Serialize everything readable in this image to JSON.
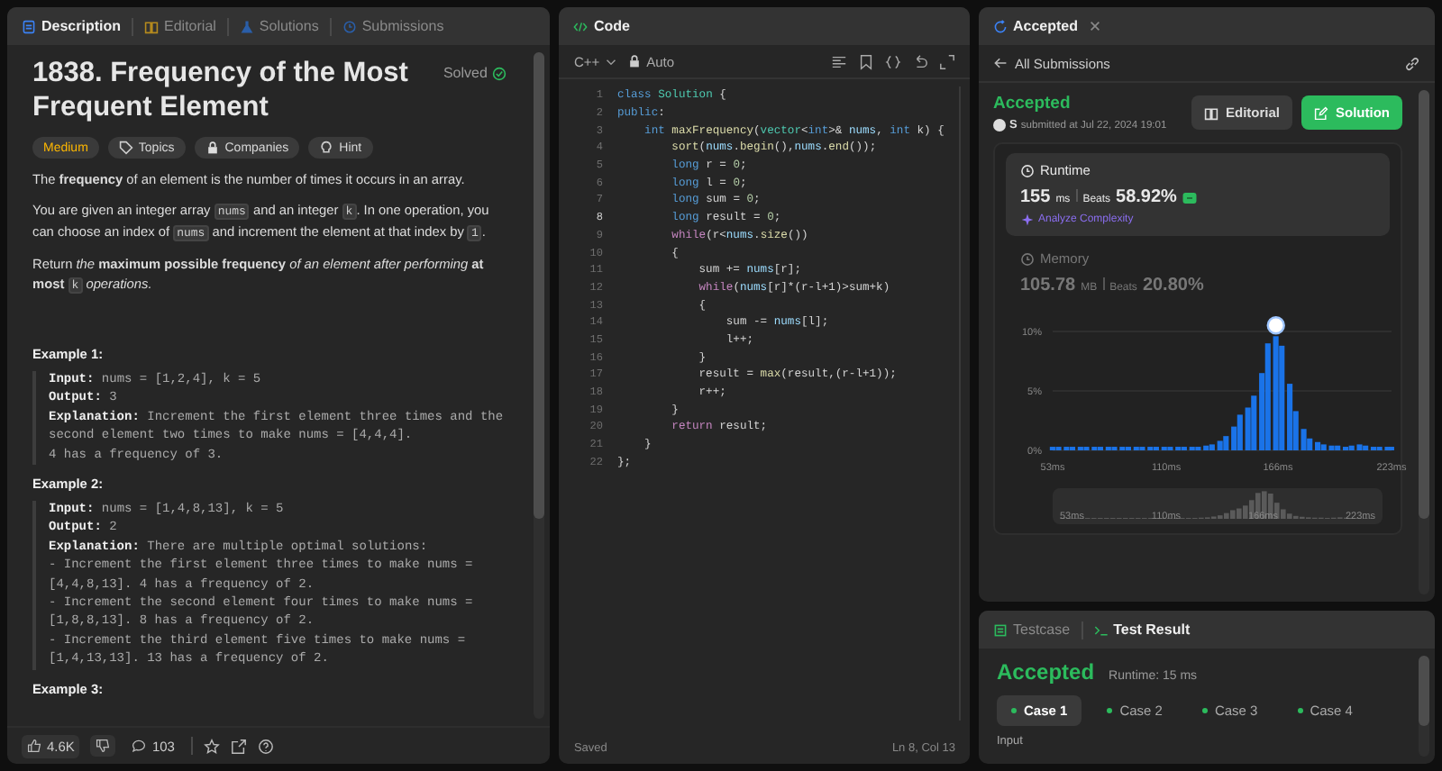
{
  "description_panel": {
    "tabs": [
      {
        "label": "Description",
        "kind": "doc",
        "selected": true
      },
      {
        "label": "Editorial",
        "kind": "book",
        "selected": false
      },
      {
        "label": "Solutions",
        "kind": "flask",
        "selected": false
      },
      {
        "label": "Submissions",
        "kind": "history",
        "selected": false
      }
    ],
    "title": "1838. Frequency of the Most Frequent Element",
    "status": "Solved",
    "tags": [
      {
        "label": "Medium",
        "kind": "difficulty"
      },
      {
        "label": "Topics",
        "kind": "tag"
      },
      {
        "label": "Companies",
        "kind": "lock"
      },
      {
        "label": "Hint",
        "kind": "bulb"
      }
    ],
    "paragraphs": [
      [
        {
          "kind": "text",
          "text": "The **frequency** of an element is the number of times it occurs in an array."
        }
      ],
      [
        {
          "kind": "text",
          "text": "You are given an integer array "
        },
        {
          "kind": "code",
          "text": "nums"
        },
        {
          "kind": "text",
          "text": " and an integer "
        },
        {
          "kind": "code",
          "text": "k"
        },
        {
          "kind": "text",
          "text": ". In one operation, you can choose an index of "
        },
        {
          "kind": "code",
          "text": "nums"
        },
        {
          "kind": "text",
          "text": " and increment the element at that index by "
        },
        {
          "kind": "code",
          "text": "1"
        },
        {
          "kind": "text",
          "text": "."
        }
      ],
      [
        {
          "kind": "text",
          "text": "Return *the* **maximum possible frequency** *of an element after performing* **at most** "
        },
        {
          "kind": "code",
          "text": "k"
        },
        {
          "kind": "text",
          "text": " *operations.*"
        }
      ]
    ],
    "examples": [
      {
        "heading": "Example 1:",
        "lines": [
          "**Input:** nums = [1,2,4], k = 5",
          "**Output:** 3",
          "**Explanation:** Increment the first element three times and the second element two times to make nums = [4,4,4].",
          "4 has a frequency of 3."
        ]
      },
      {
        "heading": "Example 2:",
        "lines": [
          "**Input:** nums = [1,4,8,13], k = 5",
          "**Output:** 2",
          "**Explanation:** There are multiple optimal solutions:",
          "- Increment the first element three times to make nums = [4,4,8,13]. 4 has a frequency of 2.",
          "- Increment the second element four times to make nums = [1,8,8,13]. 8 has a frequency of 2.",
          "- Increment the third element five times to make nums = [1,4,13,13]. 13 has a frequency of 2."
        ]
      },
      {
        "heading": "Example 3:"
      }
    ],
    "footer": {
      "likes": "4.6K",
      "comments": "103"
    }
  },
  "code_panel": {
    "title": "Code",
    "language": "C++",
    "mode": "Auto",
    "lines": [
      {
        "no": "1",
        "current": false,
        "tokens": [
          {
            "kind": "kw",
            "t": "class"
          },
          {
            "kind": "ty",
            "t": " Solution"
          },
          {
            "kind": "p",
            "t": " {"
          }
        ]
      },
      {
        "no": "2",
        "current": false,
        "tokens": [
          {
            "kind": "kw",
            "t": "public"
          },
          {
            "kind": "p",
            "t": ":"
          }
        ]
      },
      {
        "no": "3",
        "current": false,
        "tokens": [
          {
            "kind": "kw",
            "t": "    int"
          },
          {
            "kind": "fn",
            "t": " maxFrequency"
          },
          {
            "kind": "p",
            "t": "("
          },
          {
            "kind": "ty",
            "t": "vector"
          },
          {
            "kind": "p",
            "t": "<"
          },
          {
            "kind": "kw",
            "t": "int"
          },
          {
            "kind": "p",
            "t": ">& "
          },
          {
            "kind": "var",
            "t": "nums"
          },
          {
            "kind": "p",
            "t": ", "
          },
          {
            "kind": "kw",
            "t": "int"
          },
          {
            "kind": "p",
            "t": " k) {"
          }
        ]
      },
      {
        "no": "4",
        "current": false,
        "tokens": [
          {
            "kind": "fn",
            "t": "        sort"
          },
          {
            "kind": "p",
            "t": "("
          },
          {
            "kind": "var",
            "t": "nums"
          },
          {
            "kind": "p",
            "t": "."
          },
          {
            "kind": "fn",
            "t": "begin"
          },
          {
            "kind": "p",
            "t": "(),"
          },
          {
            "kind": "var",
            "t": "nums"
          },
          {
            "kind": "p",
            "t": "."
          },
          {
            "kind": "fn",
            "t": "end"
          },
          {
            "kind": "p",
            "t": "());"
          }
        ]
      },
      {
        "no": "5",
        "current": false,
        "tokens": [
          {
            "kind": "kw",
            "t": "        long"
          },
          {
            "kind": "p",
            "t": " r = "
          },
          {
            "kind": "num",
            "t": "0"
          },
          {
            "kind": "p",
            "t": ";"
          }
        ]
      },
      {
        "no": "6",
        "current": false,
        "tokens": [
          {
            "kind": "kw",
            "t": "        long"
          },
          {
            "kind": "p",
            "t": " l = "
          },
          {
            "kind": "num",
            "t": "0"
          },
          {
            "kind": "p",
            "t": ";"
          }
        ]
      },
      {
        "no": "7",
        "current": false,
        "tokens": [
          {
            "kind": "kw",
            "t": "        long"
          },
          {
            "kind": "p",
            "t": " sum = "
          },
          {
            "kind": "num",
            "t": "0"
          },
          {
            "kind": "p",
            "t": ";"
          }
        ]
      },
      {
        "no": "8",
        "current": true,
        "tokens": [
          {
            "kind": "kw",
            "t": "        long"
          },
          {
            "kind": "p",
            "t": " result = "
          },
          {
            "kind": "num",
            "t": "0"
          },
          {
            "kind": "p",
            "t": ";"
          }
        ]
      },
      {
        "no": "9",
        "current": false,
        "tokens": [
          {
            "kind": "ctl",
            "t": "        while"
          },
          {
            "kind": "p",
            "t": "(r<"
          },
          {
            "kind": "var",
            "t": "nums"
          },
          {
            "kind": "p",
            "t": "."
          },
          {
            "kind": "fn",
            "t": "size"
          },
          {
            "kind": "p",
            "t": "())"
          }
        ]
      },
      {
        "no": "10",
        "current": false,
        "tokens": [
          {
            "kind": "p",
            "t": "        {"
          }
        ]
      },
      {
        "no": "11",
        "current": false,
        "tokens": [
          {
            "kind": "p",
            "t": "            sum += "
          },
          {
            "kind": "var",
            "t": "nums"
          },
          {
            "kind": "p",
            "t": "[r];"
          }
        ]
      },
      {
        "no": "12",
        "current": false,
        "tokens": [
          {
            "kind": "ctl",
            "t": "            while"
          },
          {
            "kind": "p",
            "t": "("
          },
          {
            "kind": "var",
            "t": "nums"
          },
          {
            "kind": "p",
            "t": "[r]*(r-l+1)>sum+k)"
          }
        ]
      },
      {
        "no": "13",
        "current": false,
        "tokens": [
          {
            "kind": "p",
            "t": "            {"
          }
        ]
      },
      {
        "no": "14",
        "current": false,
        "tokens": [
          {
            "kind": "p",
            "t": "                sum -= "
          },
          {
            "kind": "var",
            "t": "nums"
          },
          {
            "kind": "p",
            "t": "[l];"
          }
        ]
      },
      {
        "no": "15",
        "current": false,
        "tokens": [
          {
            "kind": "p",
            "t": "                l++;"
          }
        ]
      },
      {
        "no": "16",
        "current": false,
        "tokens": [
          {
            "kind": "p",
            "t": "            }"
          }
        ]
      },
      {
        "no": "17",
        "current": false,
        "tokens": [
          {
            "kind": "p",
            "t": "            result = "
          },
          {
            "kind": "fn",
            "t": "max"
          },
          {
            "kind": "p",
            "t": "(result,(r-l+1));"
          }
        ]
      },
      {
        "no": "18",
        "current": false,
        "tokens": [
          {
            "kind": "p",
            "t": "            r++;"
          }
        ]
      },
      {
        "no": "19",
        "current": false,
        "tokens": [
          {
            "kind": "p",
            "t": "        }"
          }
        ]
      },
      {
        "no": "20",
        "current": false,
        "tokens": [
          {
            "kind": "ctl",
            "t": "        return"
          },
          {
            "kind": "p",
            "t": " result;"
          }
        ]
      },
      {
        "no": "21",
        "current": false,
        "tokens": [
          {
            "kind": "p",
            "t": "    }"
          }
        ]
      },
      {
        "no": "22",
        "current": false,
        "tokens": [
          {
            "kind": "p",
            "t": "};"
          }
        ]
      }
    ],
    "save_state": "Saved",
    "cursor": "Ln 8, Col 13"
  },
  "submission_panel": {
    "tab": "Accepted",
    "back_link": "All Submissions",
    "verdict": "Accepted",
    "user": "S",
    "submitted": "submitted at Jul 22, 2024 19:01",
    "buttons": [
      {
        "label": "Editorial",
        "kind": "secondary"
      },
      {
        "label": "Solution",
        "kind": "primary"
      }
    ],
    "metrics": [
      {
        "label": "Runtime",
        "value": "155",
        "unit": "ms",
        "beats_label": "Beats",
        "beats": "58.92%",
        "selected": true,
        "link": "Analyze Complexity"
      },
      {
        "label": "Memory",
        "value": "105.78",
        "unit": "MB",
        "beats_label": "Beats",
        "beats": "20.80%",
        "selected": false
      }
    ],
    "chart_data": {
      "type": "bar",
      "x": [
        53,
        56,
        60,
        63,
        67,
        70,
        74,
        77,
        81,
        84,
        88,
        91,
        95,
        98,
        102,
        105,
        109,
        112,
        116,
        119,
        123,
        126,
        130,
        133,
        137,
        140,
        144,
        147,
        151,
        154,
        158,
        161,
        165,
        168,
        172,
        175,
        179,
        182,
        186,
        189,
        193,
        196,
        200,
        203,
        207,
        210,
        214,
        217,
        221,
        223
      ],
      "series": [
        {
          "color": "#1a73e8",
          "values": [
            0.3,
            0.3,
            0.3,
            0.3,
            0.3,
            0.3,
            0.3,
            0.3,
            0.3,
            0.3,
            0.3,
            0.3,
            0.3,
            0.3,
            0.3,
            0.3,
            0.3,
            0.3,
            0.3,
            0.3,
            0.3,
            0.3,
            0.4,
            0.5,
            0.8,
            1.2,
            2.0,
            3.0,
            3.6,
            4.6,
            6.5,
            9.0,
            9.6,
            8.8,
            5.6,
            3.3,
            1.8,
            1.0,
            0.7,
            0.5,
            0.4,
            0.4,
            0.3,
            0.4,
            0.5,
            0.4,
            0.3,
            0.3,
            0.3,
            0.3
          ]
        }
      ],
      "xlim": [
        53,
        223
      ],
      "ylim": [
        0,
        10
      ],
      "xticks": [
        {
          "value": 53,
          "label": "53ms"
        },
        {
          "value": 110,
          "label": "110ms"
        },
        {
          "value": 166,
          "label": "166ms"
        },
        {
          "value": 223,
          "label": "223ms"
        }
      ],
      "yticks": [
        {
          "value": 0,
          "label": "0%"
        },
        {
          "value": 5,
          "label": "5%"
        },
        {
          "value": 10,
          "label": "10%"
        }
      ]
    },
    "overview_labels": [
      "53ms",
      "110ms",
      "166ms",
      "223ms"
    ]
  },
  "result_panel": {
    "tabs": [
      {
        "label": "Testcase",
        "kind": "list",
        "selected": false
      },
      {
        "label": "Test Result",
        "kind": "terminal",
        "selected": true
      }
    ],
    "verdict": "Accepted",
    "runtime": "Runtime: 15 ms",
    "cases": [
      {
        "label": "Case 1",
        "selected": true
      },
      {
        "label": "Case 2",
        "selected": false
      },
      {
        "label": "Case 3",
        "selected": false
      },
      {
        "label": "Case 4",
        "selected": false
      }
    ],
    "input_label": "Input"
  }
}
